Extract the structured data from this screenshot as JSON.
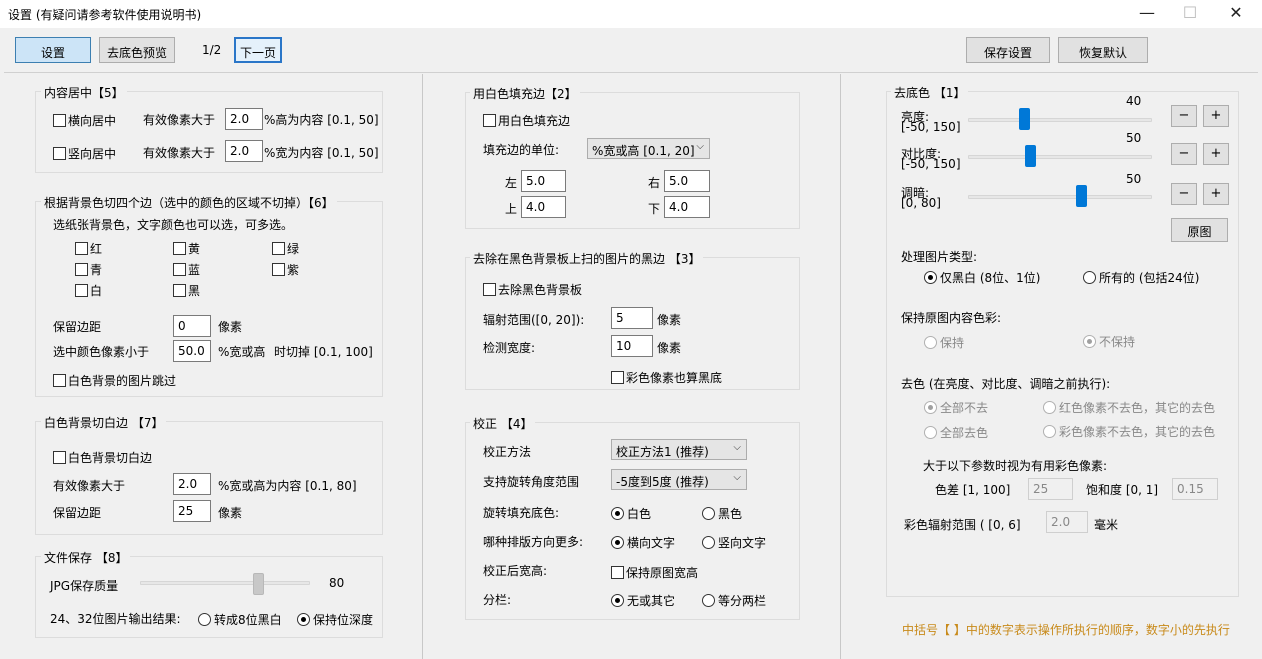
{
  "window": {
    "title": "设置 (有疑问请参考软件使用说明书)",
    "minimize": "—",
    "maximize": "☐",
    "close": "✕"
  },
  "toolbar": {
    "settings": "设置",
    "preview": "去底色预览",
    "page": "1/2",
    "next": "下一页",
    "save": "保存设置",
    "restore": "恢复默认"
  },
  "center": {
    "title": "内容居中【5】",
    "h_label": "横向居中",
    "h_desc": "有效像素大于",
    "h_value": "2.0",
    "h_unit": "%高为内容 [0.1, 50]",
    "v_label": "竖向居中",
    "v_desc": "有效像素大于",
    "v_value": "2.0",
    "v_unit": "%宽为内容 [0.1, 50]"
  },
  "bgcut": {
    "title": "根据背景色切四个边（选中的颜色的区域不切掉）【6】",
    "desc": "选纸张背景色，文字颜色也可以选，可多选。",
    "colors": [
      "红",
      "黄",
      "绿",
      "青",
      "蓝",
      "紫",
      "白",
      "黑"
    ],
    "margin_label": "保留边距",
    "margin_value": "0",
    "margin_unit": "像素",
    "ratio_label": "选中颜色像素小于",
    "ratio_value": "50.0",
    "ratio_unit1": "%宽或高",
    "ratio_unit2": "时切掉 [0.1, 100]",
    "skip_label": "白色背景的图片跳过"
  },
  "whitecut": {
    "title": "白色背景切白边 【7】",
    "check_label": "白色背景切白边",
    "pixel_label": "有效像素大于",
    "pixel_value": "2.0",
    "pixel_unit": "%宽或高为内容 [0.1, 80]",
    "margin_label": "保留边距",
    "margin_value": "25",
    "margin_unit": "像素"
  },
  "filesave": {
    "title": "文件保存 【8】",
    "jpg_label": "JPG保存质量",
    "jpg_value": "80",
    "jpg_quality": 80,
    "out_label": "24、32位图片输出结果:",
    "opt1": "转成8位黑白",
    "opt2": "保持位深度"
  },
  "whitefill": {
    "title": "用白色填充边【2】",
    "check_label": "用白色填充边",
    "unit_label": "填充边的单位:",
    "unit_value": "%宽或高 [0.1, 20]",
    "left_label": "左",
    "left_value": "5.0",
    "right_label": "右",
    "right_value": "5.0",
    "top_label": "上",
    "top_value": "4.0",
    "bottom_label": "下",
    "bottom_value": "4.0"
  },
  "blackedge": {
    "title": "去除在黑色背景板上扫的图片的黑边 【3】",
    "check_label": "去除黑色背景板",
    "range_label": "辐射范围([0, 20]):",
    "range_value": "5",
    "range_unit": "像素",
    "width_label": "检测宽度:",
    "width_value": "10",
    "width_unit": "像素",
    "color_label": "彩色像素也算黑底"
  },
  "correction": {
    "title": "校正 【4】",
    "method_label": "校正方法",
    "method_value": "校正方法1 (推荐)",
    "range_label": "支持旋转角度范围",
    "range_value": "-5度到5度 (推荐)",
    "fill_label": "旋转填充底色:",
    "fill_opt1": "白色",
    "fill_opt2": "黑色",
    "layout_label": "哪种排版方向更多:",
    "layout_opt1": "横向文字",
    "layout_opt2": "竖向文字",
    "size_label": "校正后宽高:",
    "size_check": "保持原图宽高",
    "column_label": "分栏:",
    "column_opt1": "无或其它",
    "column_opt2": "等分两栏"
  },
  "removebg": {
    "title": "去底色 【1】",
    "brightness_label": "亮度:",
    "brightness_range": "[-50, 150]",
    "brightness_value": "40",
    "brightness_level": 40,
    "contrast_label": "对比度:",
    "contrast_range": "[-50, 150]",
    "contrast_value": "50",
    "contrast_level": 50,
    "dark_label": "调暗:",
    "dark_range": "[0, 80]",
    "dark_value": "50",
    "dark_level": 50,
    "minus": "−",
    "plus": "+",
    "original": "原图",
    "type_label": "处理图片类型:",
    "type_opt1": "仅黑白 (8位、1位)",
    "type_opt2": "所有的 (包括24位)",
    "keep_label": "保持原图内容色彩:",
    "keep_opt1": "保持",
    "keep_opt2": "不保持",
    "decolor_label": "去色 (在亮度、对比度、调暗之前执行):",
    "dc_opt1": "全部不去",
    "dc_opt2": "红色像素不去色，其它的去色",
    "dc_opt3": "全部去色",
    "dc_opt4": "彩色像素不去色，其它的去色",
    "param_label": "大于以下参数时视为有用彩色像素:",
    "diff_label": "色差 [1, 100]",
    "diff_value": "25",
    "sat_label": "饱和度 [0, 1]",
    "sat_value": "0.15",
    "radius_label": "彩色辐射范围 ( [0, 6]",
    "radius_value": "2.0",
    "radius_unit": "毫米"
  },
  "footer_note": "中括号【 】中的数字表示操作所执行的顺序，数字小的先执行"
}
